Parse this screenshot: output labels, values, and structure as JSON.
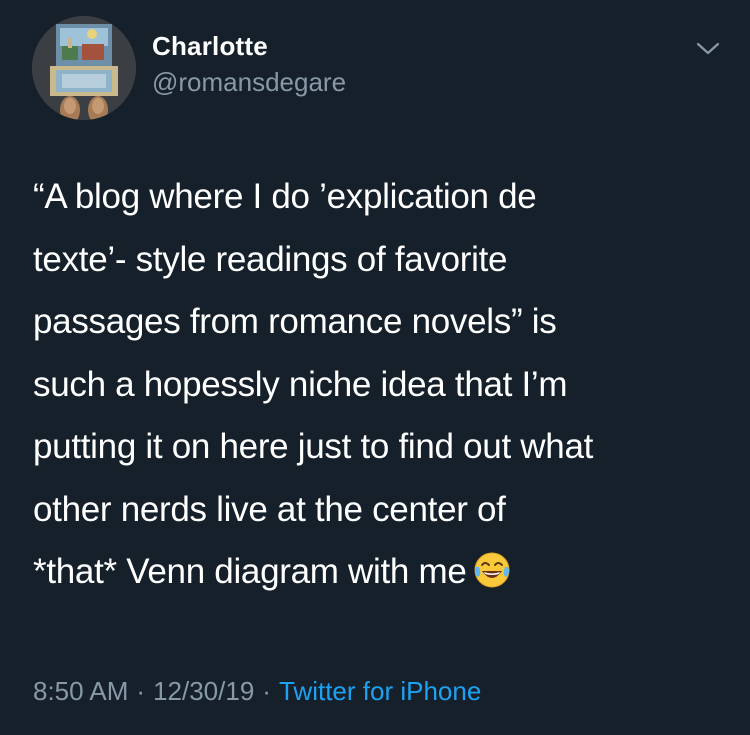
{
  "user": {
    "display_name": "Charlotte",
    "handle": "@romansdegare"
  },
  "tweet": {
    "lines": [
      "“A blog where I do ’explication de",
      "texte’- style readings of favorite",
      "passages from romance novels” is",
      "such a hopessly niche idea that I’m",
      "putting it on here just to find out what",
      "other nerds live at the center of",
      "*that* Venn diagram with me"
    ],
    "emoji": "face-with-tears-of-joy"
  },
  "meta": {
    "time": "8:50 AM",
    "separator": "·",
    "date": "12/30/19",
    "source": "Twitter for iPhone"
  },
  "colors": {
    "background": "#15202b",
    "text": "#ffffff",
    "secondary_text": "#8899a6",
    "link": "#1da1f2"
  }
}
